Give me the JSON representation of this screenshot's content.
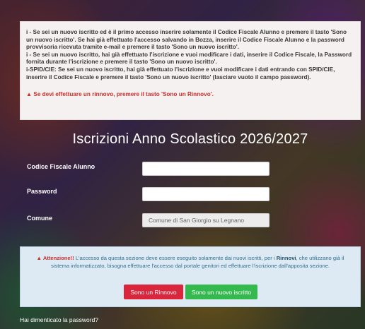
{
  "info": {
    "line1_icon": "i",
    "line1": " - Se sei un nuovo iscritto ed è il primo accesso inserire solamente il Codice Fiscale Alunno e premere il tasto 'Sono un nuovo iscritto'. Se hai già effettuato l'accesso salvando in Bozza, inserire il Codice Fiscale Alunno e la password provvisoria ricevuta tramite e-mail e premere il tasto 'Sono un nuovo iscritto'.",
    "line2_icon": "i",
    "line2": " - Se sei un nuovo iscritto, hai già effettuato l'iscrizione e vuoi modificare i dati, inserire il Codice Fiscale, la Password fornita durante l'iscrizione e premere il tasto 'Sono un nuovo iscritto'.",
    "line3_icon": "i",
    "line3": "-SPID/CIE: Se sei un nuovo iscritto, hai già effettuato l'iscrizione e vuoi modificare i dati entrando con SPID/CIE, inserire il Codice Fiscale e premere il tasto 'Sono un nuovo iscritto' (lasciare vuoto il campo password).",
    "alert_icon": "▲",
    "alert": " Se devi effettuare un rinnovo, premere il tasto 'Sono un Rinnovo'."
  },
  "title": "Iscrizioni Anno Scolastico 2026/2027",
  "form": {
    "codice_label": "Codice Fiscale Alunno",
    "codice_value": "",
    "password_label": "Password",
    "password_value": "",
    "comune_label": "Comune",
    "comune_value": "Comune di San Giorgio su Legnano"
  },
  "warning": {
    "icon": "▲",
    "prefix": " Attenzione!!",
    "text1": " L'accesso da questa sezione deve essere eseguito solamente dai nuovi iscritti, per i ",
    "bold": "Rinnovi",
    "text2": ", che utilizzano già il sistema informatizzato, bisogna effettuare l'accesso dal portale genitori ed effettuare l'iscrizione dall'apposita sezione."
  },
  "buttons": {
    "rinnovo": "Sono un Rinnovo",
    "nuovo": "Sono un nuovo iscritto"
  },
  "forgot": "Hai dimenticato la password?",
  "colors": {
    "red": "#d9263d",
    "green": "#34b94f",
    "info_blue": "#dde9f3"
  }
}
